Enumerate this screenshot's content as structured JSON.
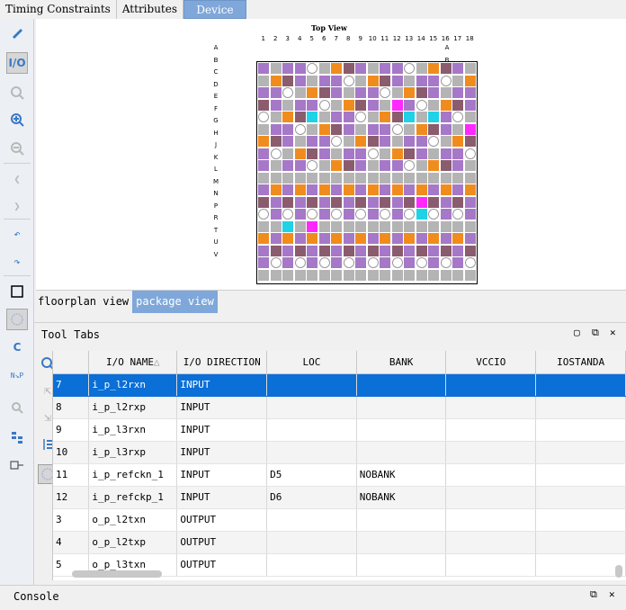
{
  "tabs": [
    {
      "label": "Timing Constraints"
    },
    {
      "label": "Attributes"
    },
    {
      "label": "Device"
    }
  ],
  "canvas": {
    "title": "Top View",
    "columns": [
      "1",
      "2",
      "3",
      "4",
      "5",
      "6",
      "7",
      "8",
      "9",
      "10",
      "11",
      "12",
      "13",
      "14",
      "15",
      "16",
      "17",
      "18"
    ],
    "rows": [
      "A",
      "B",
      "C",
      "D",
      "E",
      "F",
      "G",
      "H",
      "J",
      "K",
      "L",
      "M",
      "N",
      "P",
      "R",
      "T",
      "U",
      "V"
    ]
  },
  "view_tabs": [
    {
      "label": "floorplan view"
    },
    {
      "label": "package view"
    }
  ],
  "panel": {
    "title": "Tool Tabs",
    "icons": [
      "restore-icon",
      "maximize-icon",
      "close-icon"
    ]
  },
  "table": {
    "headers": [
      "",
      "I/O NAME",
      "I/O DIRECTION",
      "LOC",
      "BANK",
      "VCCIO",
      "IOSTANDA"
    ],
    "rows": [
      {
        "num": "7",
        "name": "i_p_l2rxn",
        "dir": "INPUT",
        "loc": "",
        "bank": "",
        "vccio": "",
        "std": ""
      },
      {
        "num": "8",
        "name": "i_p_l2rxp",
        "dir": "INPUT",
        "loc": "",
        "bank": "",
        "vccio": "",
        "std": ""
      },
      {
        "num": "9",
        "name": "i_p_l3rxn",
        "dir": "INPUT",
        "loc": "",
        "bank": "",
        "vccio": "",
        "std": ""
      },
      {
        "num": "10",
        "name": "i_p_l3rxp",
        "dir": "INPUT",
        "loc": "",
        "bank": "",
        "vccio": "",
        "std": ""
      },
      {
        "num": "11",
        "name": "i_p_refckn_1",
        "dir": "INPUT",
        "loc": "D5",
        "bank": "NOBANK",
        "vccio": "",
        "std": ""
      },
      {
        "num": "12",
        "name": "i_p_refckp_1",
        "dir": "INPUT",
        "loc": "D6",
        "bank": "NOBANK",
        "vccio": "",
        "std": ""
      },
      {
        "num": "3",
        "name": "o_p_l2txn",
        "dir": "OUTPUT",
        "loc": "",
        "bank": "",
        "vccio": "",
        "std": ""
      },
      {
        "num": "4",
        "name": "o_p_l2txp",
        "dir": "OUTPUT",
        "loc": "",
        "bank": "",
        "vccio": "",
        "std": ""
      },
      {
        "num": "5",
        "name": "o_p_l3txn",
        "dir": "OUTPUT",
        "loc": "",
        "bank": "",
        "vccio": "",
        "std": ""
      }
    ]
  },
  "console": {
    "title": "Console"
  },
  "colors": {
    "purple": "#a678c8",
    "orange": "#f08c1e",
    "gray": "#b4b4b4",
    "cyan": "#1fd2e6",
    "magenta": "#ff28ff",
    "brown": "#8a5c6e",
    "accent": "#7fa7d9",
    "selected": "#0a6fd6"
  }
}
